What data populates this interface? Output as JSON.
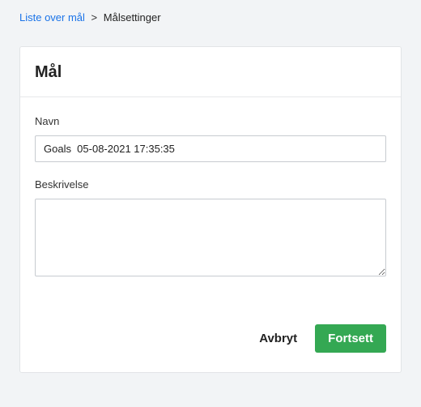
{
  "breadcrumb": {
    "link_label": "Liste over mål",
    "separator": ">",
    "current": "Målsettinger"
  },
  "card": {
    "title": "Mål"
  },
  "form": {
    "name": {
      "label": "Navn",
      "value": "Goals  05-08-2021 17:35:35"
    },
    "description": {
      "label": "Beskrivelse",
      "value": ""
    }
  },
  "actions": {
    "cancel_label": "Avbryt",
    "continue_label": "Fortsett"
  }
}
